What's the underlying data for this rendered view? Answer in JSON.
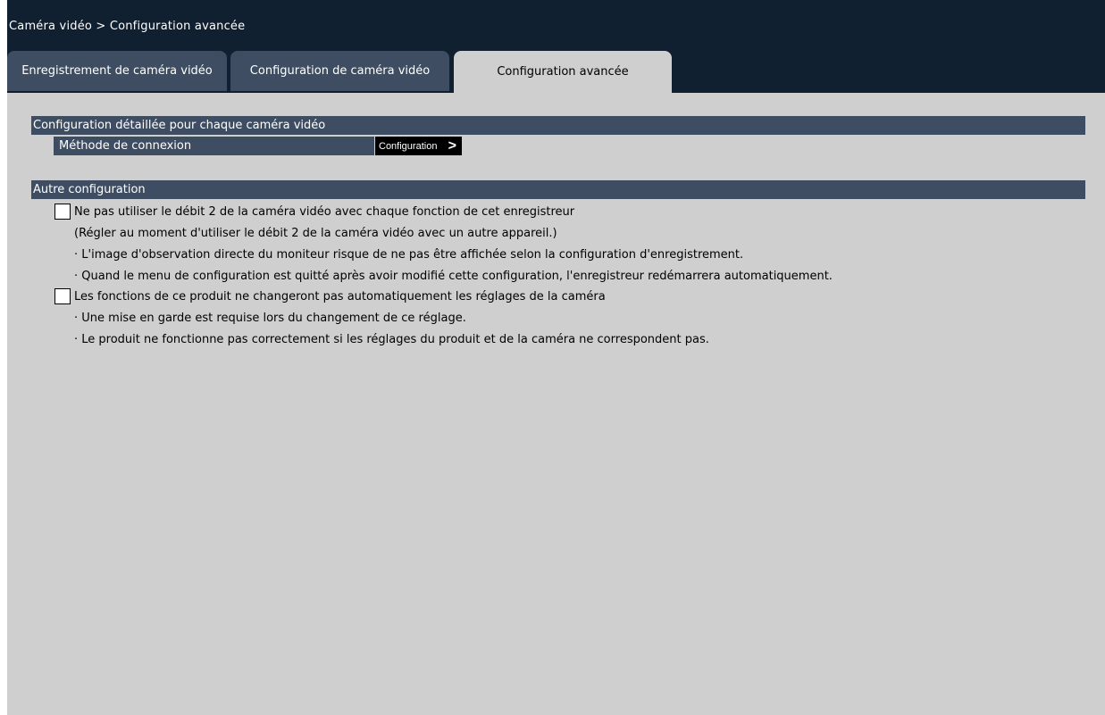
{
  "breadcrumb": "Caméra vidéo > Configuration avancée",
  "tabs": [
    {
      "label": "Enregistrement de caméra vidéo",
      "active": false
    },
    {
      "label": "Configuration de caméra vidéo",
      "active": false
    },
    {
      "label": "Configuration avancée",
      "active": true
    }
  ],
  "detail_section": {
    "title": "Configuration détaillée pour chaque caméra vidéo",
    "connection_label": "Méthode de connexion",
    "config_button": "Configuration",
    "chevron": ">"
  },
  "other_section": {
    "title": "Autre configuration",
    "options": [
      {
        "checked": false,
        "label": "Ne pas utiliser le débit 2 de la caméra vidéo avec chaque fonction de cet enregistreur",
        "note": "(Régler au moment d'utiliser le débit 2 de la caméra vidéo avec un autre appareil.)",
        "bullets": [
          "· L'image d'observation directe du moniteur risque de ne pas être affichée selon la configuration d'enregistrement.",
          "· Quand le menu de configuration est quitté après avoir modifié cette configuration, l'enregistreur redémarrera automatiquement."
        ]
      },
      {
        "checked": false,
        "label": "Les fonctions de ce produit ne changeront pas automatiquement les réglages de la caméra",
        "bullets": [
          "· Une mise en garde est requise lors du changement de ce réglage.",
          "· Le produit ne fonctionne pas correctement si les réglages du produit et de la caméra ne correspondent pas."
        ]
      }
    ]
  },
  "colors": {
    "frame": "#102030",
    "header_bar": "#3e4d62",
    "content_bg": "#cfcfcf",
    "button_bg": "#000000"
  }
}
